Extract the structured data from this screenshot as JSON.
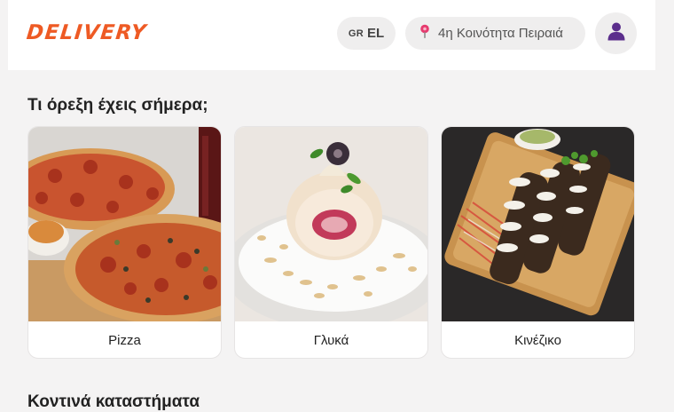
{
  "header": {
    "logo": "DELIVERY",
    "language": {
      "code": "GR",
      "label": "EL"
    },
    "location": "4η Κοινότητα Πειραιά"
  },
  "sections": {
    "appetite_title": "Τι όρεξη έχεις σήμερα;",
    "nearby_title": "Κοντινά καταστήματα"
  },
  "categories": [
    {
      "label": "Pizza"
    },
    {
      "label": "Γλυκά"
    },
    {
      "label": "Κινέζικο"
    }
  ],
  "colors": {
    "brand": "#ee5a24",
    "pin": "#e63b6f",
    "avatar": "#5b2e8c"
  }
}
